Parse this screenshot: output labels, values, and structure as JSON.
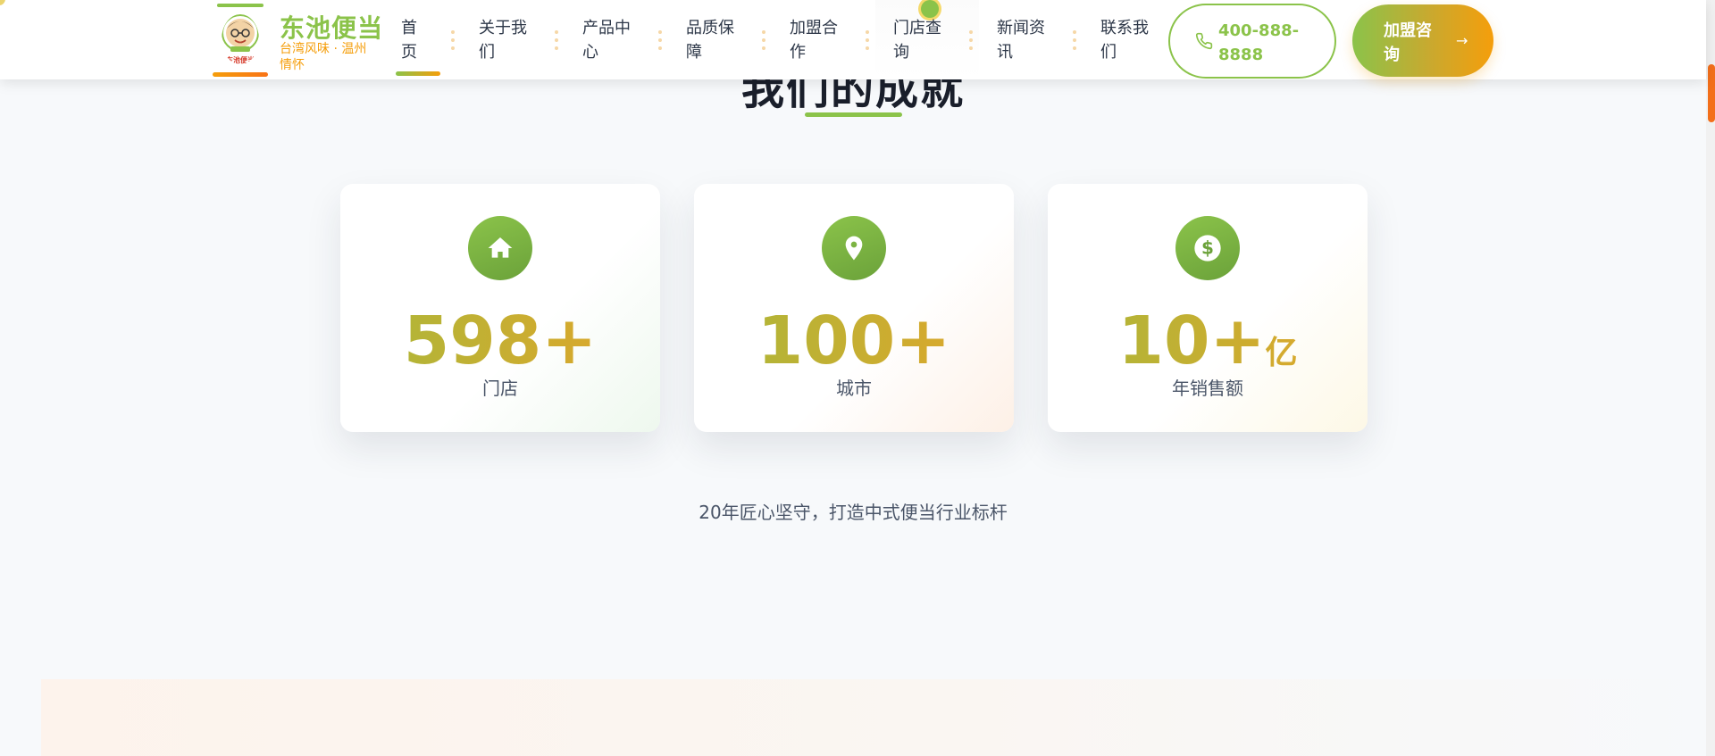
{
  "brand": {
    "name": "东池便当",
    "slogan": "台湾风味 · 温州情怀",
    "logo_text": "东池便当"
  },
  "nav": {
    "items": [
      {
        "label": "首页",
        "active": true
      },
      {
        "label": "关于我们"
      },
      {
        "label": "产品中心"
      },
      {
        "label": "品质保障"
      },
      {
        "label": "加盟合作"
      },
      {
        "label": "门店查询"
      },
      {
        "label": "新闻资讯"
      },
      {
        "label": "联系我们"
      }
    ]
  },
  "actions": {
    "phone": "400-888-8888",
    "join_label": "加盟咨询"
  },
  "section": {
    "title": "我们的成就"
  },
  "stats": [
    {
      "icon": "home-icon",
      "value": "598+",
      "unit": "",
      "label": "门店"
    },
    {
      "icon": "location-pin-icon",
      "value": "100+",
      "unit": "",
      "label": "城市"
    },
    {
      "icon": "dollar-icon",
      "value": "10+",
      "unit": "亿",
      "label": "年销售额"
    }
  ],
  "tagline": "20年匠心坚守，打造中式便当行业标杆",
  "colors": {
    "primary_green": "#8bc34a",
    "accent_orange": "#f59e0b",
    "scroll_thumb": "#f36f1a"
  }
}
